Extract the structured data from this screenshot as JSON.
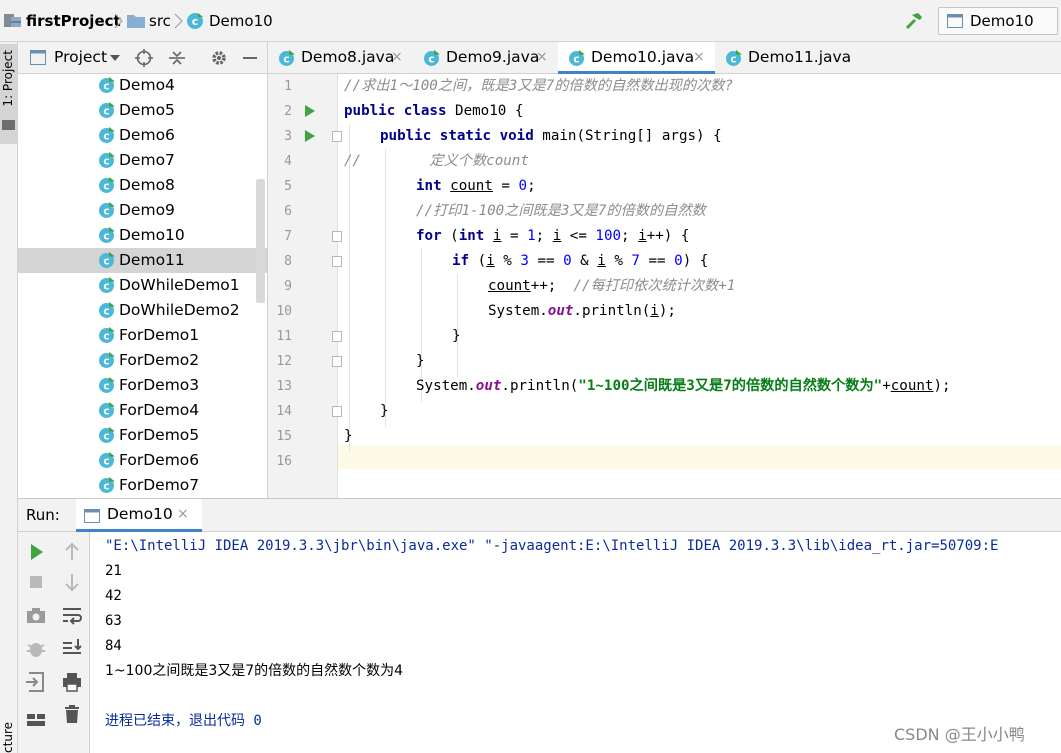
{
  "navbar": {
    "project": "firstProject",
    "folder": "src",
    "file": "Demo10",
    "run_config": "Demo10"
  },
  "left_strip": {
    "project_tab": "1: Project",
    "structure_tab": "cture"
  },
  "project_panel": {
    "title": "Project",
    "items": [
      "Demo4",
      "Demo5",
      "Demo6",
      "Demo7",
      "Demo8",
      "Demo9",
      "Demo10",
      "Demo11",
      "DoWhileDemo1",
      "DoWhileDemo2",
      "ForDemo1",
      "ForDemo2",
      "ForDemo3",
      "ForDemo4",
      "ForDemo5",
      "ForDemo6",
      "ForDemo7"
    ],
    "selected": "Demo11"
  },
  "editor": {
    "tabs": [
      {
        "label": "Demo8.java",
        "active": false
      },
      {
        "label": "Demo9.java",
        "active": false
      },
      {
        "label": "Demo10.java",
        "active": true
      },
      {
        "label": "Demo11.java",
        "active": false
      }
    ],
    "close_glyph": "×",
    "line_numbers": [
      "1",
      "2",
      "3",
      "4",
      "5",
      "6",
      "7",
      "8",
      "9",
      "10",
      "11",
      "12",
      "13",
      "14",
      "15",
      "16"
    ],
    "code": {
      "l1": "//求出1～100之间，既是3又是7的倍数的自然数出现的次数?",
      "l2_kw": "public class",
      "l2_rest": " Demo10 {",
      "l3_kw": "public static void",
      "l3_rest": " main(String[] args) {",
      "l4": "//        定义个数count",
      "l5_kw": "int",
      "l5_var": "count",
      "l5_eq": " = ",
      "l5_num": "0",
      "l5_end": ";",
      "l6": "//打印1-100之间既是3又是7的倍数的自然数",
      "l7_kw1": "for",
      "l7_p": " (",
      "l7_kw2": "int",
      "l7_i1": "i",
      "l7_eq": " = ",
      "l7_n1": "1",
      "l7_semi1": "; ",
      "l7_i2": "i",
      "l7_le": " <= ",
      "l7_n2": "100",
      "l7_semi2": "; ",
      "l7_i3": "i",
      "l7_end": "++) {",
      "l8_kw": "if",
      "l8_p": " (",
      "l8_i1": "i",
      "l8_mod1": " % ",
      "l8_n1": "3",
      "l8_eq1": " == ",
      "l8_n2": "0",
      "l8_and": " & ",
      "l8_i2": "i",
      "l8_mod2": " % ",
      "l8_n3": "7",
      "l8_eq2": " == ",
      "l8_n4": "0",
      "l8_end": ") {",
      "l9_var": "count",
      "l9_mid": "++;  ",
      "l9_cmt": "//每打印依次统计次数+1",
      "l10_a": "System.",
      "l10_fld": "out",
      "l10_b": ".println(",
      "l10_i": "i",
      "l10_c": ");",
      "l11": "}",
      "l12": "}",
      "l13_a": "System.",
      "l13_fld": "out",
      "l13_b": ".println(",
      "l13_str": "\"1~100之间既是3又是7的倍数的自然数个数为\"",
      "l13_plus": "+",
      "l13_var": "count",
      "l13_c": ");",
      "l14": "}",
      "l15": "}"
    }
  },
  "run_panel": {
    "label": "Run:",
    "tab": "Demo10",
    "console": [
      "\"E:\\IntelliJ IDEA 2019.3.3\\jbr\\bin\\java.exe\" \"-javaagent:E:\\IntelliJ IDEA 2019.3.3\\lib\\idea_rt.jar=50709:E",
      "21",
      "42",
      "63",
      "84",
      "1~100之间既是3又是7的倍数的自然数个数为4",
      "",
      "进程已结束，退出代码 0"
    ]
  },
  "watermark": "CSDN @王小小鸭",
  "colors": {
    "accent": "#4083c9",
    "run_green": "#3fa33f",
    "keyword": "#00008b",
    "number": "#0000ff",
    "comment": "#8c8c8c",
    "string": "#067d17",
    "field": "#871094"
  }
}
